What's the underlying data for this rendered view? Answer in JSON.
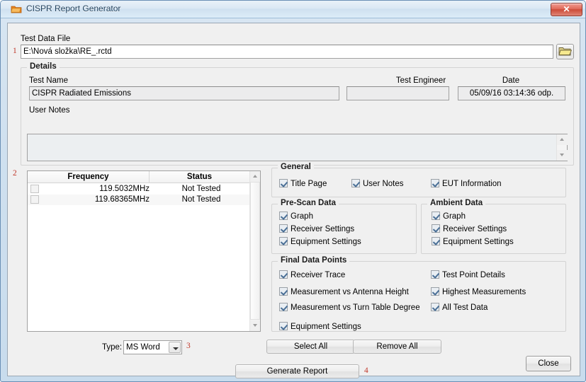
{
  "window": {
    "title": "CISPR Report Generator",
    "icon": "app-folder-icon",
    "close_label": "✕"
  },
  "file_section": {
    "label": "Test Data File",
    "path_value": "E:\\Nová složka\\RE_.rctd",
    "browse_icon": "open-folder-icon",
    "marker": "1"
  },
  "details": {
    "title": "Details",
    "test_name_label": "Test Name",
    "test_name_value": "CISPR Radiated Emissions",
    "test_engineer_label": "Test Engineer",
    "test_engineer_value": "",
    "date_label": "Date",
    "date_value": "05/09/16 03:14:36 odp.",
    "user_notes_label": "User Notes",
    "user_notes_value": ""
  },
  "frequency_list": {
    "marker": "2",
    "columns": [
      "Frequency",
      "Status"
    ],
    "rows": [
      {
        "frequency": "119.5032MHz",
        "status": "Not Tested"
      },
      {
        "frequency": "119.68365MHz",
        "status": "Not Tested"
      }
    ]
  },
  "type_selector": {
    "label": "Type:",
    "value": "MS Word",
    "marker": "3",
    "options": [
      "MS Word"
    ]
  },
  "general": {
    "title": "General",
    "items": [
      {
        "label": "Title Page",
        "checked": true
      },
      {
        "label": "User Notes",
        "checked": true
      },
      {
        "label": "EUT Information",
        "checked": true
      }
    ]
  },
  "pre_scan": {
    "title": "Pre-Scan Data",
    "items": [
      {
        "label": "Graph",
        "checked": true
      },
      {
        "label": "Receiver Settings",
        "checked": true
      },
      {
        "label": "Equipment Settings",
        "checked": true
      }
    ]
  },
  "ambient": {
    "title": "Ambient Data",
    "items": [
      {
        "label": "Graph",
        "checked": true
      },
      {
        "label": "Receiver Settings",
        "checked": true
      },
      {
        "label": "Equipment Settings",
        "checked": true
      }
    ]
  },
  "final_points": {
    "title": "Final Data Points",
    "left_items": [
      {
        "label": "Receiver Trace",
        "checked": true
      },
      {
        "label": "Measurement vs Antenna Height",
        "checked": true
      },
      {
        "label": "Measurement vs Turn Table Degree",
        "checked": true
      },
      {
        "label": "Equipment Settings",
        "checked": true
      }
    ],
    "right_items": [
      {
        "label": "Test Point Details",
        "checked": true
      },
      {
        "label": "Highest Measurements",
        "checked": true
      },
      {
        "label": "All Test Data",
        "checked": true
      }
    ]
  },
  "buttons": {
    "select_all": "Select All",
    "remove_all": "Remove All",
    "generate_report": "Generate Report",
    "generate_marker": "4",
    "close": "Close"
  }
}
